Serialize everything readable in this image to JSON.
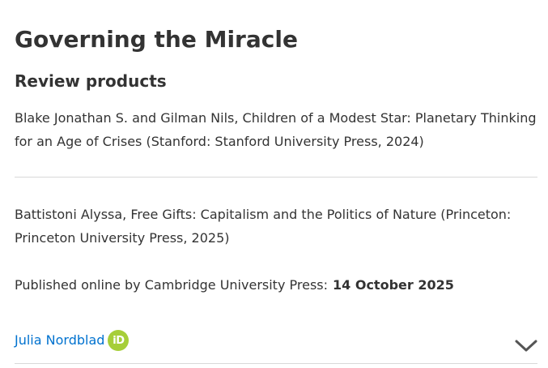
{
  "article": {
    "title": "Governing the Miracle",
    "section_heading": "Review products",
    "review_products": [
      "Blake Jonathan S. and Gilman Nils, Children of a Modest Star: Planetary Thinking for an Age of Crises (Stanford: Stanford University Press, 2024)",
      "Battistoni Alyssa, Free Gifts: Capitalism and the Politics of Nature (Princeton: Princeton University Press, 2025)"
    ],
    "published_label": "Published online by Cambridge University Press:",
    "published_date": "14 October 2025",
    "author": {
      "name": "Julia Nordblad",
      "orcid_badge": "iD",
      "orcid_icon": "orcid-icon"
    },
    "expand_icon": "chevron-down-icon"
  },
  "colors": {
    "text": "#333333",
    "link": "#0072cf",
    "orcid": "#a6ce39",
    "divider": "#d9d9d9",
    "chevron": "#555555"
  }
}
